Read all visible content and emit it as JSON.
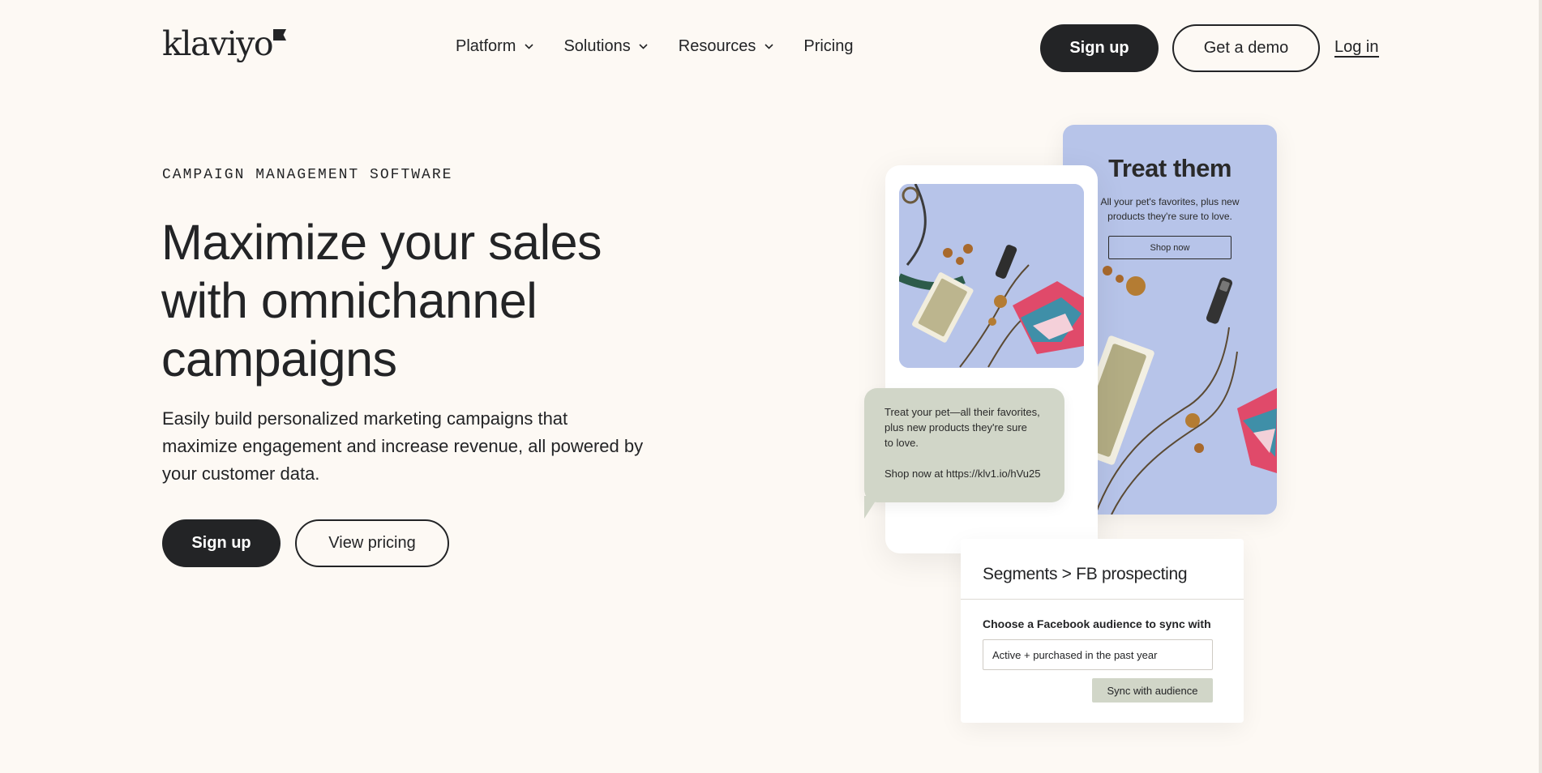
{
  "brand": {
    "logo_text": "klaviyo"
  },
  "nav": {
    "items": [
      {
        "label": "Platform",
        "has_dropdown": true
      },
      {
        "label": "Solutions",
        "has_dropdown": true
      },
      {
        "label": "Resources",
        "has_dropdown": true
      },
      {
        "label": "Pricing",
        "has_dropdown": false
      }
    ]
  },
  "header": {
    "signup_label": "Sign up",
    "demo_label": "Get a demo",
    "login_label": "Log in"
  },
  "hero": {
    "eyebrow": "CAMPAIGN MANAGEMENT SOFTWARE",
    "headline_lines": [
      "Maximize your sales",
      "with omnichannel",
      "campaigns"
    ],
    "subcopy_lines": [
      "Easily build personalized marketing campaigns that",
      "maximize engagement and increase revenue, all powered by",
      "your customer data."
    ],
    "cta_signup": "Sign up",
    "cta_pricing": "View pricing"
  },
  "email_preview": {
    "title": "Treat them",
    "body_lines": [
      "All your pet's favorites, plus new",
      "products they're sure to love."
    ],
    "button_label": "Shop now"
  },
  "sms_preview": {
    "lines": [
      "Treat your pet—all their favorites,",
      "plus new products they're sure",
      "to love."
    ],
    "link_line": "Shop now at https://klv1.io/hVu25"
  },
  "segment_panel": {
    "title": "Segments > FB prospecting",
    "label": "Choose a Facebook audience to sync with",
    "input_value": "Active + purchased in the past year",
    "sync_button": "Sync with audience"
  },
  "colors": {
    "background": "#fdf9f4",
    "ink": "#232426",
    "periwinkle": "#b7c4e9",
    "sage": "#d1d6c8"
  }
}
